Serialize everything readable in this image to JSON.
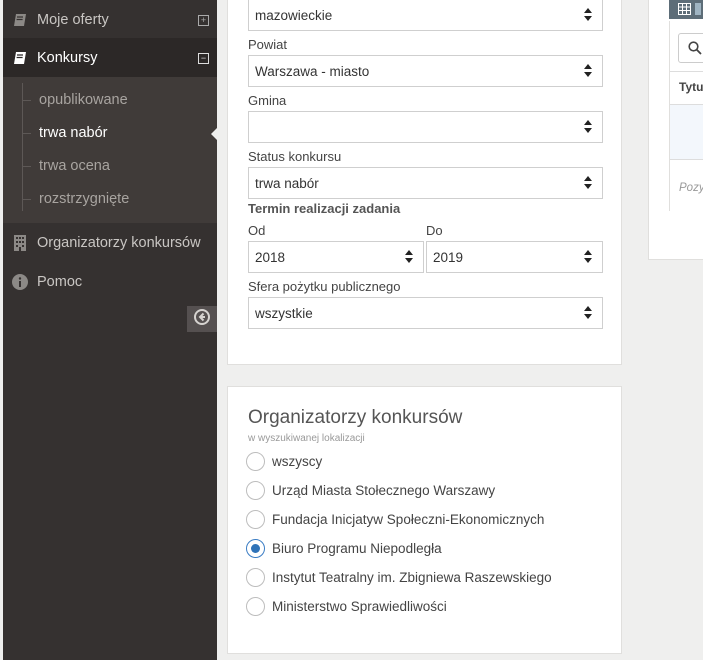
{
  "sidebar": {
    "items": [
      {
        "label": "Moje oferty",
        "icon": "book-icon"
      },
      {
        "label": "Konkursy",
        "icon": "book-open-icon"
      },
      {
        "label": "Organizatorzy konkursów",
        "icon": "building-icon"
      },
      {
        "label": "Pomoc",
        "icon": "info-icon"
      }
    ],
    "submenu": [
      {
        "label": "opublikowane"
      },
      {
        "label": "trwa nabór"
      },
      {
        "label": "trwa ocena"
      },
      {
        "label": "rozstrzygnięte"
      }
    ]
  },
  "filters": {
    "wojewodztwo_value": "mazowieckie",
    "powiat_label": "Powiat",
    "powiat_value": "Warszawa - miasto",
    "gmina_label": "Gmina",
    "gmina_value": "",
    "status_label": "Status konkursu",
    "status_value": "trwa nabór",
    "termin_label": "Termin realizacji zadania",
    "od_label": "Od",
    "od_value": "2018",
    "do_label": "Do",
    "do_value": "2019",
    "sfera_label": "Sfera pożytku publicznego",
    "sfera_value": "wszystkie"
  },
  "organizers": {
    "title": "Organizatorzy konkursów",
    "subtitle": "w wyszukiwanej lokalizacji",
    "options": [
      {
        "label": "wszyscy",
        "checked": false
      },
      {
        "label": "Urząd Miasta Stołecznego Warszawy",
        "checked": false
      },
      {
        "label": "Fundacja Inicjatyw Społeczni-Ekonomicznych",
        "checked": false
      },
      {
        "label": "Biuro Programu Niepodległa",
        "checked": true
      },
      {
        "label": "Instytut Teatralny im. Zbigniewa Raszewskiego",
        "checked": false
      },
      {
        "label": "Ministerstwo Sprawiedliwości",
        "checked": false
      }
    ]
  },
  "results": {
    "column_title": "Tytu",
    "footer": "Pozy"
  }
}
